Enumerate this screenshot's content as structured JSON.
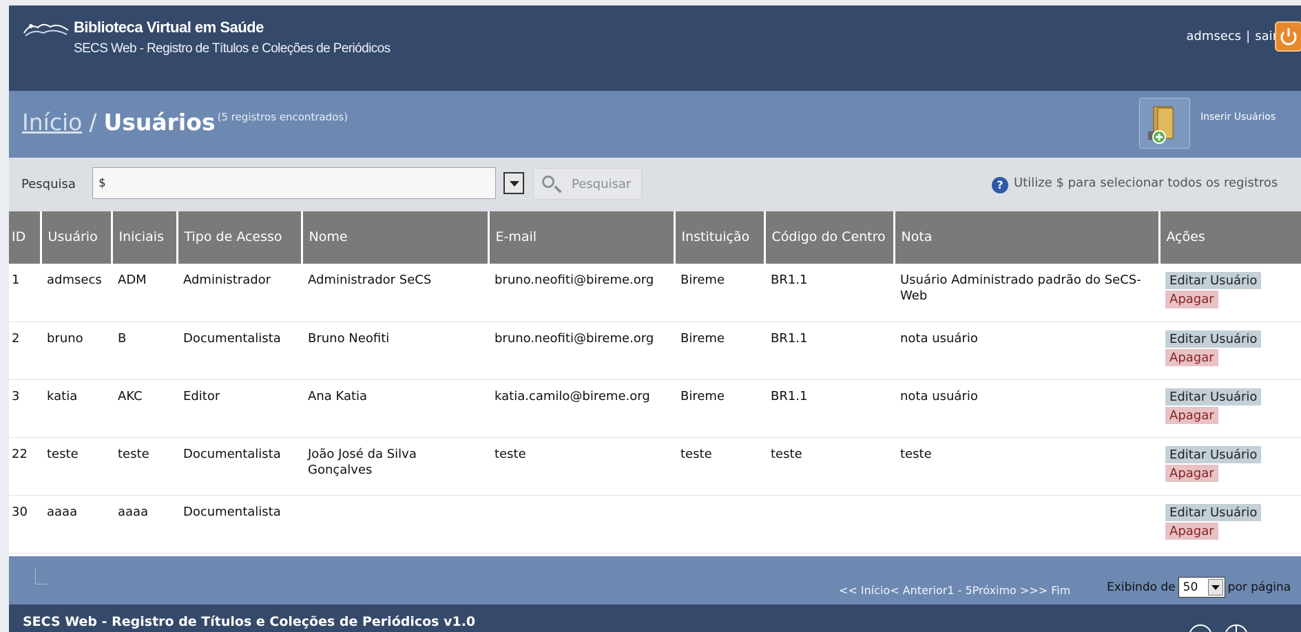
{
  "header": {
    "site_title": "Biblioteca Virtual em Saúde",
    "site_subtitle": "SECS Web - Registro de Títulos e Coleções de Periódicos",
    "username": "admsecs",
    "separator": "|",
    "logout": "sair"
  },
  "titlebar": {
    "home_link": "Início",
    "separator": "/",
    "page_title": "Usuários",
    "record_count": "(5 registros encontrados)",
    "insert_label": "Inserir Usuários"
  },
  "search": {
    "label": "Pesquisa",
    "value": "$",
    "button": "Pesquisar",
    "hint": "Utilize $ para selecionar todos os registros"
  },
  "table": {
    "columns": [
      "ID",
      "Usuário",
      "Iniciais",
      "Tipo de Acesso",
      "Nome",
      "E-mail",
      "Instituição",
      "Código do Centro",
      "Nota",
      "Ações"
    ],
    "rows": [
      {
        "id": "1",
        "user": "admsecs",
        "initials": "ADM",
        "access": "Administrador",
        "name": "Administrador SeCS",
        "email": "bruno.neofiti@bireme.org",
        "institution": "Bireme",
        "center": "BR1.1",
        "note": "Usuário Administrado padrão do SeCS-Web",
        "edit": "Editar Usuário",
        "delete": "Apagar"
      },
      {
        "id": "2",
        "user": "bruno",
        "initials": "B",
        "access": "Documentalista",
        "name": "Bruno Neofiti",
        "email": "bruno.neofiti@bireme.org",
        "institution": "Bireme",
        "center": "BR1.1",
        "note": "nota usuário",
        "edit": "Editar Usuário",
        "delete": "Apagar"
      },
      {
        "id": "3",
        "user": "katia",
        "initials": "AKC",
        "access": "Editor",
        "name": "Ana Katia",
        "email": "katia.camilo@bireme.org",
        "institution": "Bireme",
        "center": "BR1.1",
        "note": "nota usuário",
        "edit": "Editar Usuário",
        "delete": "Apagar"
      },
      {
        "id": "22",
        "user": "teste",
        "initials": "teste",
        "access": "Documentalista",
        "name": "João José da Silva Gonçalves",
        "email": "teste",
        "institution": "teste",
        "center": "teste",
        "note": "teste",
        "edit": "Editar Usuário",
        "delete": "Apagar"
      },
      {
        "id": "30",
        "user": "aaaa",
        "initials": "aaaa",
        "access": "Documentalista",
        "name": "",
        "email": "",
        "institution": "",
        "center": "",
        "note": "",
        "edit": "Editar Usuário",
        "delete": "Apagar"
      }
    ]
  },
  "pagination": {
    "first": "<< Início",
    "prev": "< Anterior",
    "range": "1 - 5",
    "next": "Próximo >",
    "last": ">> Fim",
    "showing_prefix": "Exibindo de",
    "page_size": "50",
    "showing_suffix": "por página"
  },
  "footer": {
    "text": "SECS Web - Registro de Títulos e Coleções de Periódicos v1.0"
  },
  "colors": {
    "header_bg": "#35496a",
    "titlebar_bg": "#6d89b2",
    "table_header_bg": "#7a7a7a",
    "edit_bg": "#c3d0d7",
    "delete_bg": "#e8c2c4"
  }
}
